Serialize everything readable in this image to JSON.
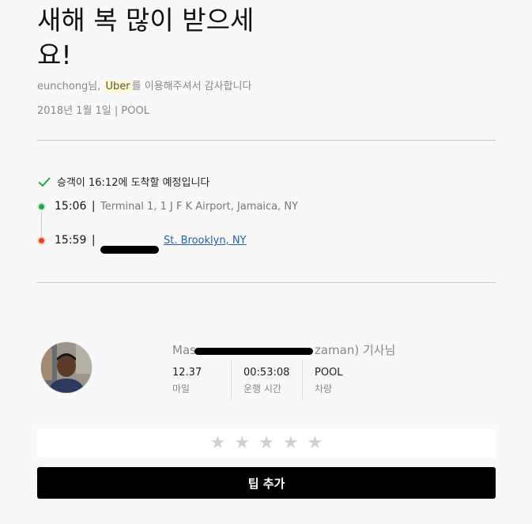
{
  "header": {
    "headline": "새해 복 많이 받으세요!",
    "greeting_prefix": "eunchong님, ",
    "greeting_brand": "Uber",
    "greeting_suffix": "를 이용해주셔서 감사합니다",
    "meta": "2018년 1월 1일 | POOL"
  },
  "route": {
    "eta_text": "승객이 16:12에 도착할 예정입니다",
    "pickup": {
      "time": "15:06",
      "separator": "|",
      "address": "Terminal 1, 1 J F K Airport, Jamaica, NY"
    },
    "dropoff": {
      "time": "15:59",
      "separator": "|",
      "address": "St. Brooklyn, NY"
    }
  },
  "driver": {
    "name_start": "Mas",
    "name_end": "zaman) 기사님",
    "stats": [
      {
        "value": "12.37",
        "label": "마일"
      },
      {
        "value": "00:53:08",
        "label": "운행 시간"
      },
      {
        "value": "POOL",
        "label": "차량"
      }
    ]
  },
  "rating": {
    "stars": [
      "★",
      "★",
      "★",
      "★",
      "★"
    ],
    "value": 0
  },
  "actions": {
    "tip_label": "팁 추가"
  },
  "colors": {
    "pickup": "#2aa34a",
    "dropoff": "#e0491c",
    "link": "#2a5ea8",
    "button": "#000000",
    "check": "#2aa34a"
  }
}
